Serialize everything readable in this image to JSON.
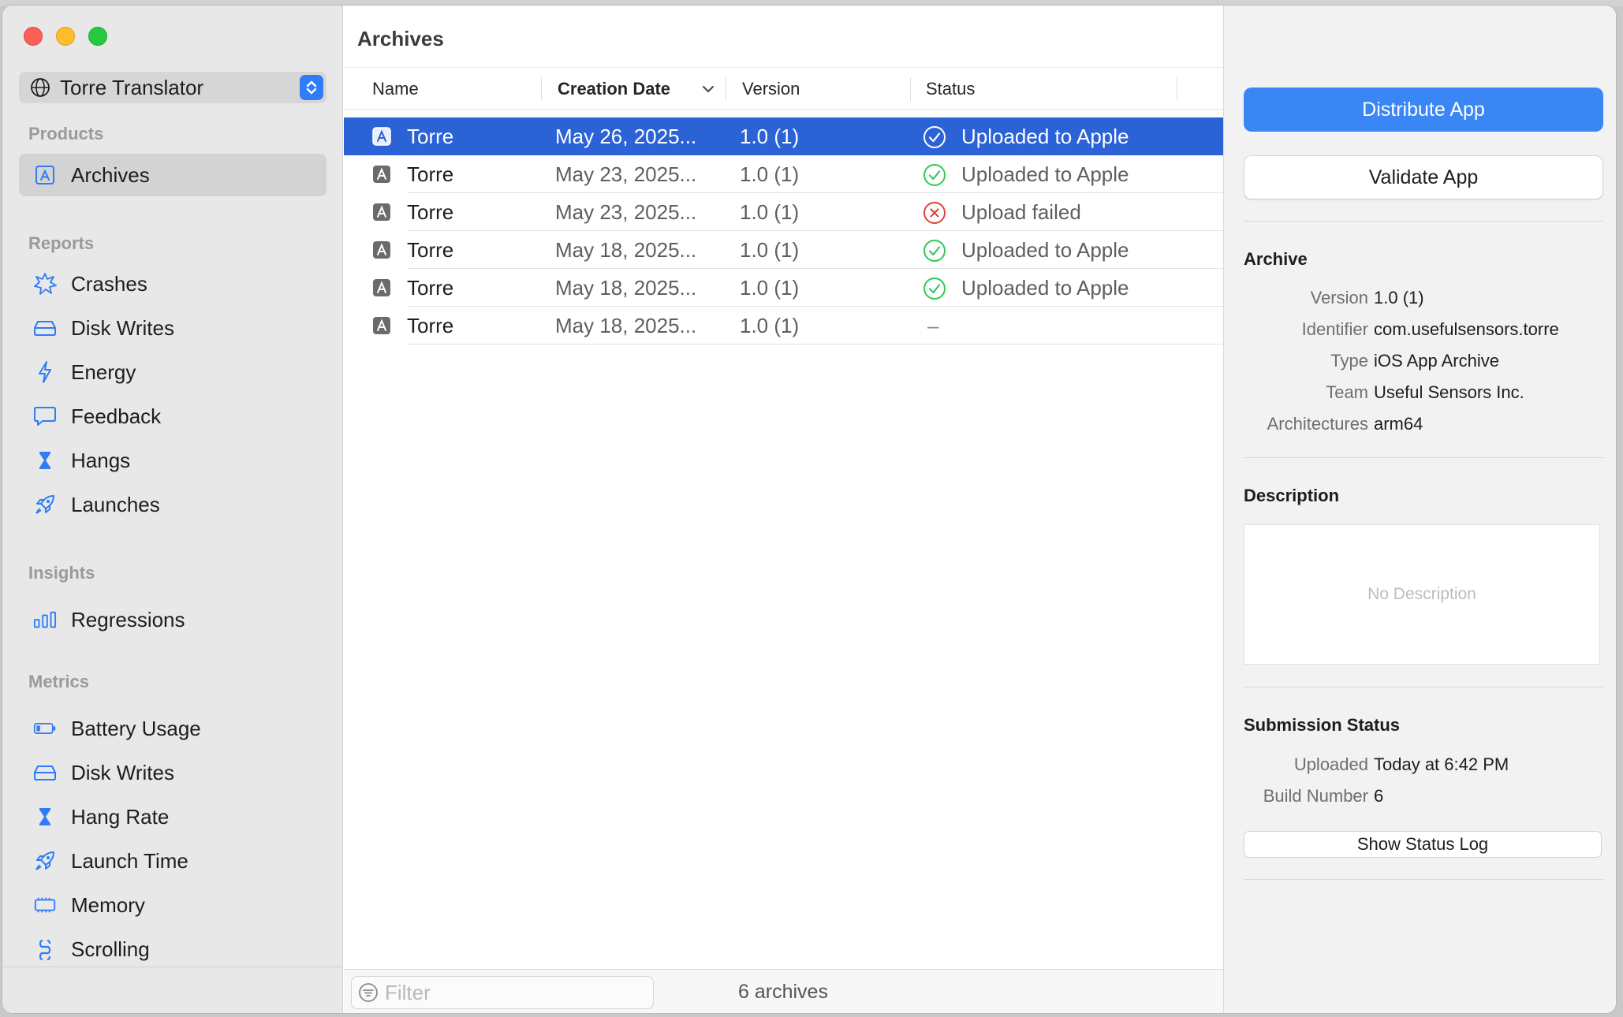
{
  "sidebar": {
    "scheme_label": "Torre Translator",
    "sections": {
      "products": "Products",
      "reports": "Reports",
      "insights": "Insights",
      "metrics": "Metrics"
    },
    "items": {
      "archives": "Archives",
      "crashes": "Crashes",
      "disk_writes": "Disk Writes",
      "energy": "Energy",
      "feedback": "Feedback",
      "hangs": "Hangs",
      "launches": "Launches",
      "regressions": "Regressions",
      "battery_usage": "Battery Usage",
      "disk_writes_metric": "Disk Writes",
      "hang_rate": "Hang Rate",
      "launch_time": "Launch Time",
      "memory": "Memory",
      "scrolling": "Scrolling"
    }
  },
  "main": {
    "title": "Archives",
    "columns": {
      "name": "Name",
      "creation_date": "Creation Date",
      "version": "Version",
      "status": "Status"
    },
    "rows": [
      {
        "name": "Torre",
        "date": "May 26, 2025...",
        "version": "1.0 (1)",
        "status": "Uploaded to Apple",
        "status_kind": "success"
      },
      {
        "name": "Torre",
        "date": "May 23, 2025...",
        "version": "1.0 (1)",
        "status": "Uploaded to Apple",
        "status_kind": "success"
      },
      {
        "name": "Torre",
        "date": "May 23, 2025...",
        "version": "1.0 (1)",
        "status": "Upload failed",
        "status_kind": "failed"
      },
      {
        "name": "Torre",
        "date": "May 18, 2025...",
        "version": "1.0 (1)",
        "status": "Uploaded to Apple",
        "status_kind": "success"
      },
      {
        "name": "Torre",
        "date": "May 18, 2025...",
        "version": "1.0 (1)",
        "status": "Uploaded to Apple",
        "status_kind": "success"
      },
      {
        "name": "Torre",
        "date": "May 18, 2025...",
        "version": "1.0 (1)",
        "status": "–",
        "status_kind": "none"
      }
    ],
    "filter_placeholder": "Filter",
    "archive_count": "6 archives"
  },
  "inspector": {
    "distribute_label": "Distribute App",
    "validate_label": "Validate App",
    "archive_heading": "Archive",
    "archive": {
      "version_key": "Version",
      "version": "1.0 (1)",
      "identifier_key": "Identifier",
      "identifier": "com.usefulsensors.torre",
      "type_key": "Type",
      "type": "iOS App Archive",
      "team_key": "Team",
      "team": "Useful Sensors Inc.",
      "arch_key": "Architectures",
      "arch": "arm64"
    },
    "description_heading": "Description",
    "description_placeholder": "No Description",
    "submission_heading": "Submission Status",
    "submission": {
      "uploaded_key": "Uploaded",
      "uploaded": "Today at 6:42 PM",
      "build_key": "Build Number",
      "build": "6"
    },
    "status_log_label": "Show Status Log"
  },
  "colors": {
    "accent": "#2f7cf6",
    "selection": "#2b62d6",
    "success": "#34c759",
    "failure": "#e0423a"
  }
}
